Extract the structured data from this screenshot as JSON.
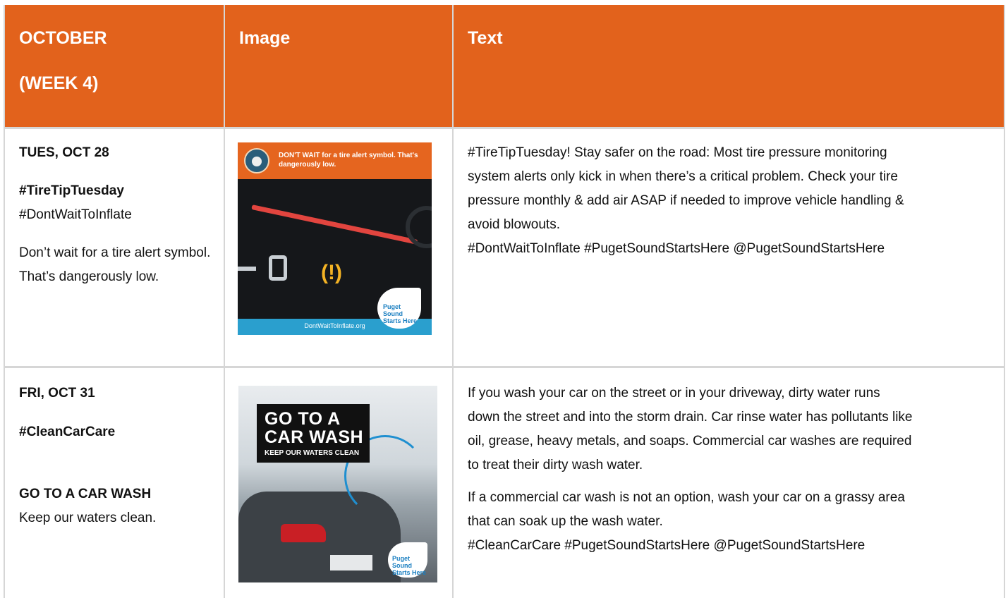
{
  "header": {
    "col1_line1": "OCTOBER",
    "col1_line2": "(WEEK 4)",
    "col2": "Image",
    "col3": "Text"
  },
  "rows": [
    {
      "date": "TUES, OCT 28",
      "tag_bold": "#TireTipTuesday",
      "tag2": "#DontWaitToInflate",
      "caption": "Don’t wait for a tire alert symbol. That’s dangerously low.",
      "image": {
        "headline": "DON'T WAIT for a tire alert symbol. That's dangerously low.",
        "warning_symbol": "(!)",
        "gauge_text": "-O",
        "badge": "Puget Sound Starts Here",
        "url": "DontWaitToInflate.org"
      },
      "text_lines": [
        "#TireTipTuesday! Stay safer on the road: Most tire pressure monitoring",
        "system alerts only kick in when there’s a critical problem. Check your tire",
        "pressure monthly & add air ASAP if needed to improve vehicle handling &",
        "avoid blowouts.",
        "#DontWaitToInflate #PugetSoundStartsHere @PugetSoundStartsHere"
      ]
    },
    {
      "date": "FRI, OCT 31",
      "tag_bold": "#CleanCarCare",
      "headline": "GO TO A CAR WASH",
      "subline": "Keep our waters clean.",
      "image": {
        "line1": "GO TO A",
        "line2": "CAR WASH",
        "line3": "KEEP OUR WATERS CLEAN",
        "badge": "Puget Sound Starts Here"
      },
      "para1_lines": [
        "If you wash your car on the street or in your driveway, dirty water runs",
        "down the street and into the storm drain. Car rinse water has pollutants like",
        "oil, grease, heavy metals, and soaps. Commercial car washes are required",
        "to treat their dirty wash water."
      ],
      "para2_lines": [
        "If a commercial car wash is not an option, wash your car on a grassy area",
        "that can soak up the wash water.",
        "#CleanCarCare #PugetSoundStartsHere @PugetSoundStartsHere"
      ]
    }
  ],
  "colors": {
    "header_bg": "#e2621c",
    "grid": "#d6d6d6"
  }
}
